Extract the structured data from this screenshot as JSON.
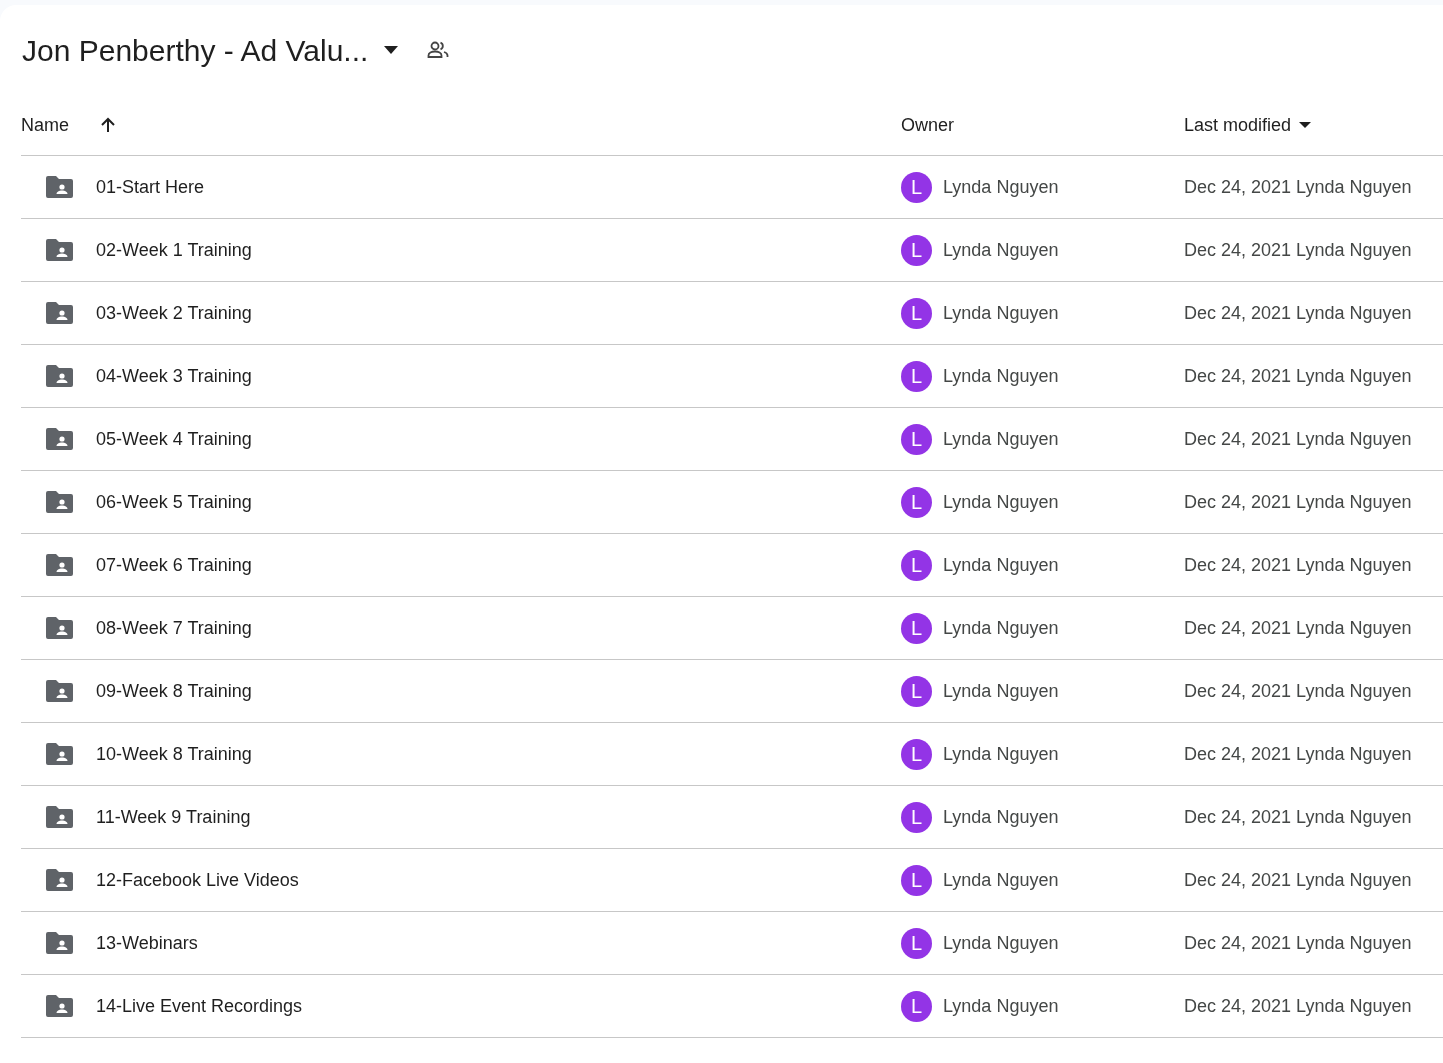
{
  "folder_title": "Jon Penberthy - Ad Valu...",
  "table": {
    "columns": [
      {
        "label": "Name",
        "sorted_ascending": true,
        "has_menu": false
      },
      {
        "label": "Owner",
        "sorted_ascending": false,
        "has_menu": false
      },
      {
        "label": "Last modified",
        "sorted_ascending": false,
        "has_menu": true
      }
    ],
    "rows": [
      {
        "name": "01-Start Here",
        "avatar": "L",
        "owner": "Lynda Nguyen",
        "modified": "Dec 24, 2021 Lynda Nguyen"
      },
      {
        "name": "02-Week 1 Training",
        "avatar": "L",
        "owner": "Lynda Nguyen",
        "modified": "Dec 24, 2021 Lynda Nguyen"
      },
      {
        "name": "03-Week 2 Training",
        "avatar": "L",
        "owner": "Lynda Nguyen",
        "modified": "Dec 24, 2021 Lynda Nguyen"
      },
      {
        "name": "04-Week 3 Training",
        "avatar": "L",
        "owner": "Lynda Nguyen",
        "modified": "Dec 24, 2021 Lynda Nguyen"
      },
      {
        "name": "05-Week 4 Training",
        "avatar": "L",
        "owner": "Lynda Nguyen",
        "modified": "Dec 24, 2021 Lynda Nguyen"
      },
      {
        "name": "06-Week 5 Training",
        "avatar": "L",
        "owner": "Lynda Nguyen",
        "modified": "Dec 24, 2021 Lynda Nguyen"
      },
      {
        "name": "07-Week 6 Training",
        "avatar": "L",
        "owner": "Lynda Nguyen",
        "modified": "Dec 24, 2021 Lynda Nguyen"
      },
      {
        "name": "08-Week 7 Training",
        "avatar": "L",
        "owner": "Lynda Nguyen",
        "modified": "Dec 24, 2021 Lynda Nguyen"
      },
      {
        "name": "09-Week 8 Training",
        "avatar": "L",
        "owner": "Lynda Nguyen",
        "modified": "Dec 24, 2021 Lynda Nguyen"
      },
      {
        "name": "10-Week 8 Training",
        "avatar": "L",
        "owner": "Lynda Nguyen",
        "modified": "Dec 24, 2021 Lynda Nguyen"
      },
      {
        "name": "11-Week 9 Training",
        "avatar": "L",
        "owner": "Lynda Nguyen",
        "modified": "Dec 24, 2021 Lynda Nguyen"
      },
      {
        "name": "12-Facebook Live Videos",
        "avatar": "L",
        "owner": "Lynda Nguyen",
        "modified": "Dec 24, 2021 Lynda Nguyen"
      },
      {
        "name": "13-Webinars",
        "avatar": "L",
        "owner": "Lynda Nguyen",
        "modified": "Dec 24, 2021 Lynda Nguyen"
      },
      {
        "name": "14-Live Event Recordings",
        "avatar": "L",
        "owner": "Lynda Nguyen",
        "modified": "Dec 24, 2021 Lynda Nguyen"
      }
    ]
  }
}
